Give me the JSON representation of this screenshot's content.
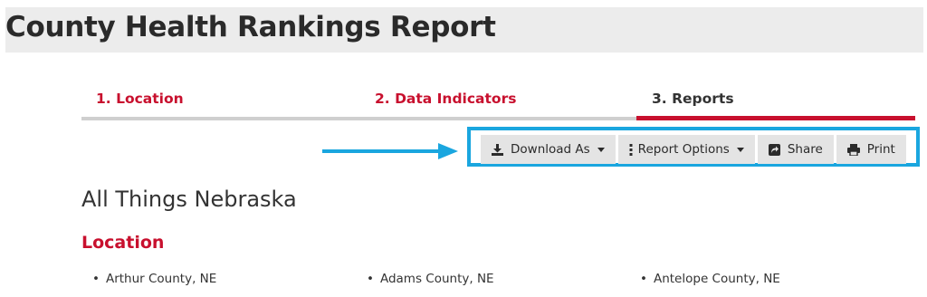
{
  "header": {
    "title": "County Health Rankings Report"
  },
  "steps": [
    {
      "label": "1. Location",
      "state": "done"
    },
    {
      "label": "2. Data Indicators",
      "state": "done"
    },
    {
      "label": "3. Reports",
      "state": "current"
    }
  ],
  "toolbar": {
    "download_label": "Download As",
    "report_options_label": "Report Options",
    "share_label": "Share",
    "print_label": "Print"
  },
  "report": {
    "title": "All Things Nebraska",
    "location_heading": "Location",
    "locations": [
      "Arthur County, NE",
      "Adams County, NE",
      "Antelope County, NE"
    ]
  },
  "colors": {
    "accent_red": "#c8102e",
    "highlight_blue": "#1aa6df",
    "button_gray": "#e4e4e4"
  }
}
